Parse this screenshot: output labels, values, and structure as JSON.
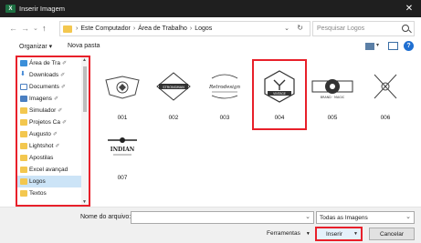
{
  "window": {
    "title": "Inserir Imagem",
    "app_icon": "excel-icon"
  },
  "nav": {
    "breadcrumbs": [
      "Este Computador",
      "Área de Trabalho",
      "Logos"
    ],
    "search_placeholder": "Pesquisar Logos"
  },
  "toolbar": {
    "organize_label": "Organizar ▾",
    "new_folder_label": "Nova pasta"
  },
  "sidebar": {
    "items": [
      {
        "label": "Área de Tra",
        "icon": "desktop-icon",
        "pinned": true
      },
      {
        "label": "Downloads",
        "icon": "download-icon",
        "pinned": true
      },
      {
        "label": "Documents",
        "icon": "document-icon",
        "pinned": true
      },
      {
        "label": "Imagens",
        "icon": "images-icon",
        "pinned": true
      },
      {
        "label": "Simulador",
        "icon": "folder-icon",
        "pinned": true
      },
      {
        "label": "Projetos Ca",
        "icon": "folder-icon",
        "pinned": true
      },
      {
        "label": "Augusto",
        "icon": "folder-icon",
        "pinned": true
      },
      {
        "label": "Lightshot",
        "icon": "folder-icon",
        "pinned": true
      },
      {
        "label": "Apostilas",
        "icon": "folder-icon",
        "pinned": false
      },
      {
        "label": "Excel avançad",
        "icon": "folder-icon",
        "pinned": false
      },
      {
        "label": "Logos",
        "icon": "folder-icon",
        "pinned": false,
        "selected": true
      },
      {
        "label": "Textos",
        "icon": "folder-icon",
        "pinned": false
      }
    ]
  },
  "files": [
    {
      "name": "001",
      "thumb_text": ""
    },
    {
      "name": "002",
      "thumb_text": "STRONGMAN"
    },
    {
      "name": "003",
      "thumb_text": "Retrodesign"
    },
    {
      "name": "004",
      "thumb_text": "VINTAGE",
      "selected": true
    },
    {
      "name": "005",
      "thumb_text": "BRAND · MAGIC"
    },
    {
      "name": "006",
      "thumb_text": ""
    },
    {
      "name": "007",
      "thumb_text": "INDIAN"
    }
  ],
  "bottom": {
    "filename_label": "Nome do arquivo:",
    "filename_value": "",
    "filetype_value": "Todas as Imagens",
    "tools_label": "Ferramentas",
    "insert_label": "Inserir",
    "cancel_label": "Cancelar"
  },
  "colors": {
    "highlight": "#e8202a",
    "accent": "#0078d7",
    "selection": "#cce4f7"
  }
}
